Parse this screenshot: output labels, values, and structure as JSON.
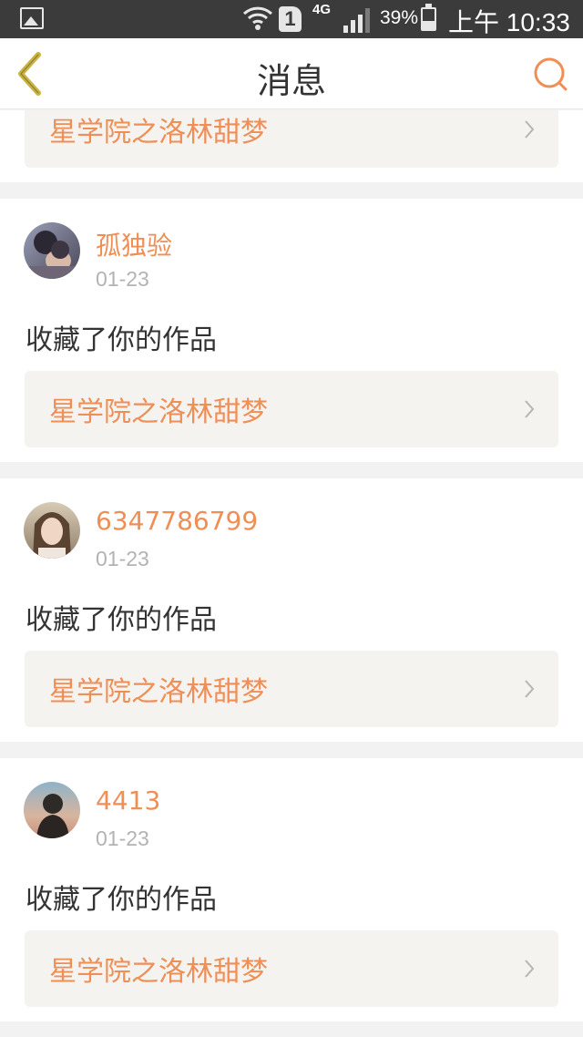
{
  "status_bar": {
    "network": "4G",
    "sim_label": "1",
    "battery_percent": "39%",
    "battery_level": 0.39,
    "time": "上午 10:33",
    "icons": [
      "picture-icon",
      "wifi-icon",
      "sim-icon",
      "signal-icon",
      "battery-icon"
    ]
  },
  "header": {
    "title": "消息",
    "back_icon": "chevron-left-icon",
    "search_icon": "search-icon"
  },
  "colors": {
    "accent": "#ef8e55",
    "back_icon": "#c9b441",
    "card_bg": "#ffffff",
    "page_bg": "#f2f2f2",
    "work_bg": "#f4f3ef",
    "date_text": "#b3b3b3",
    "status_bar_bg": "#3b3b3b"
  },
  "messages": [
    {
      "work_title": "星学院之洛林甜梦"
    },
    {
      "username": "孤独验",
      "date": "01-23",
      "action": "收藏了你的作品",
      "work_title": "星学院之洛林甜梦"
    },
    {
      "username": "6347786799",
      "date": "01-23",
      "action": "收藏了你的作品",
      "work_title": "星学院之洛林甜梦"
    },
    {
      "username": "4413",
      "date": "01-23",
      "action": "收藏了你的作品",
      "work_title": "星学院之洛林甜梦"
    }
  ]
}
